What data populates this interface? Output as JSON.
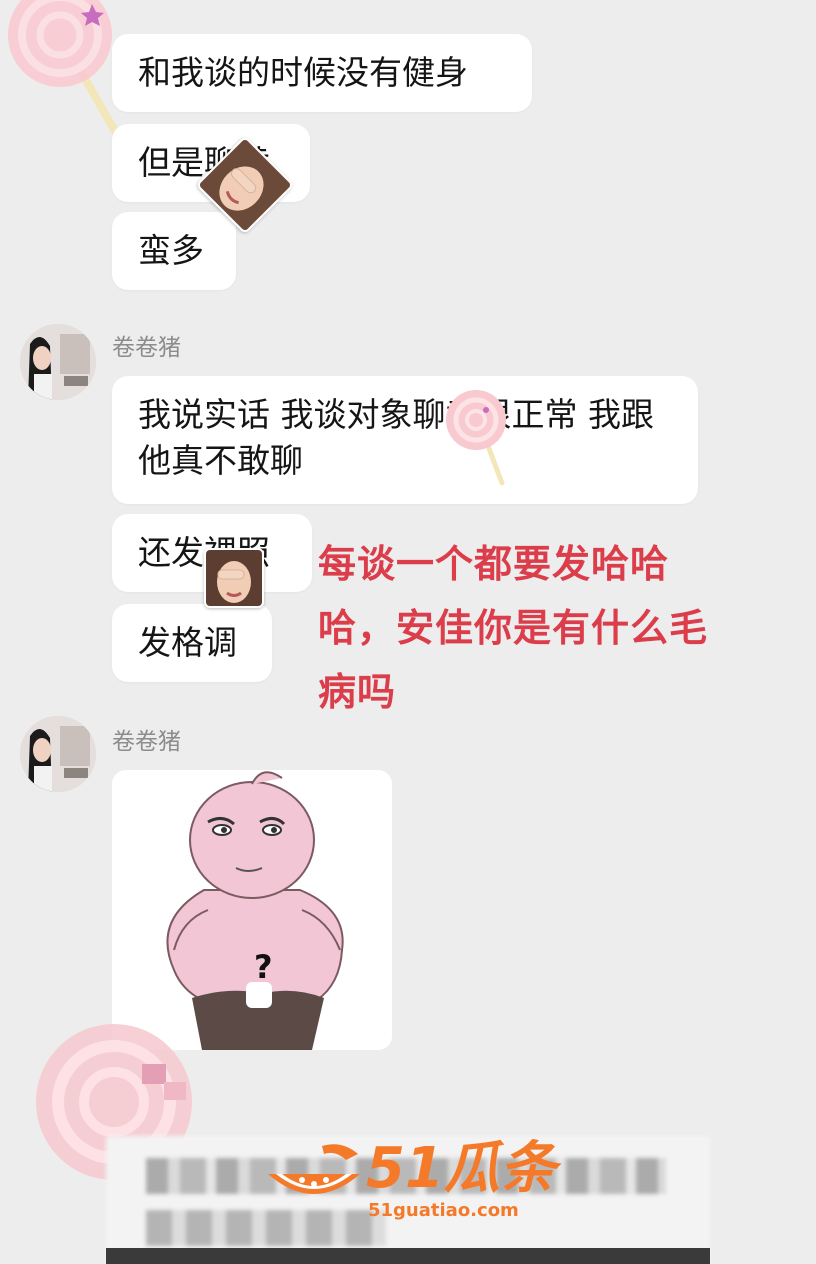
{
  "messages_top": [
    {
      "text": "和我谈的时候没有健身"
    },
    {
      "text": "但是聊黄"
    },
    {
      "text": "蛮多"
    }
  ],
  "group2": {
    "sender": "卷卷猪",
    "messages": [
      {
        "text": "我说实话 我谈对象聊黄很正常 我跟他真不敢聊"
      },
      {
        "text": "还发裸照"
      },
      {
        "text": "发格调"
      }
    ]
  },
  "annotation": {
    "text": "每谈一个都要发哈哈哈，安佳你是有什么毛病吗",
    "color": "#dc3d4b"
  },
  "group3": {
    "sender": "卷卷猪",
    "image_message": {
      "symbol": "?"
    }
  },
  "watermark": {
    "brand": "51瓜条",
    "url": "51guatiao.com",
    "color": "#f47a2a"
  },
  "colors": {
    "background": "#ededed",
    "bubble": "#ffffff",
    "text": "#151515",
    "sender": "#8c8c8c"
  }
}
